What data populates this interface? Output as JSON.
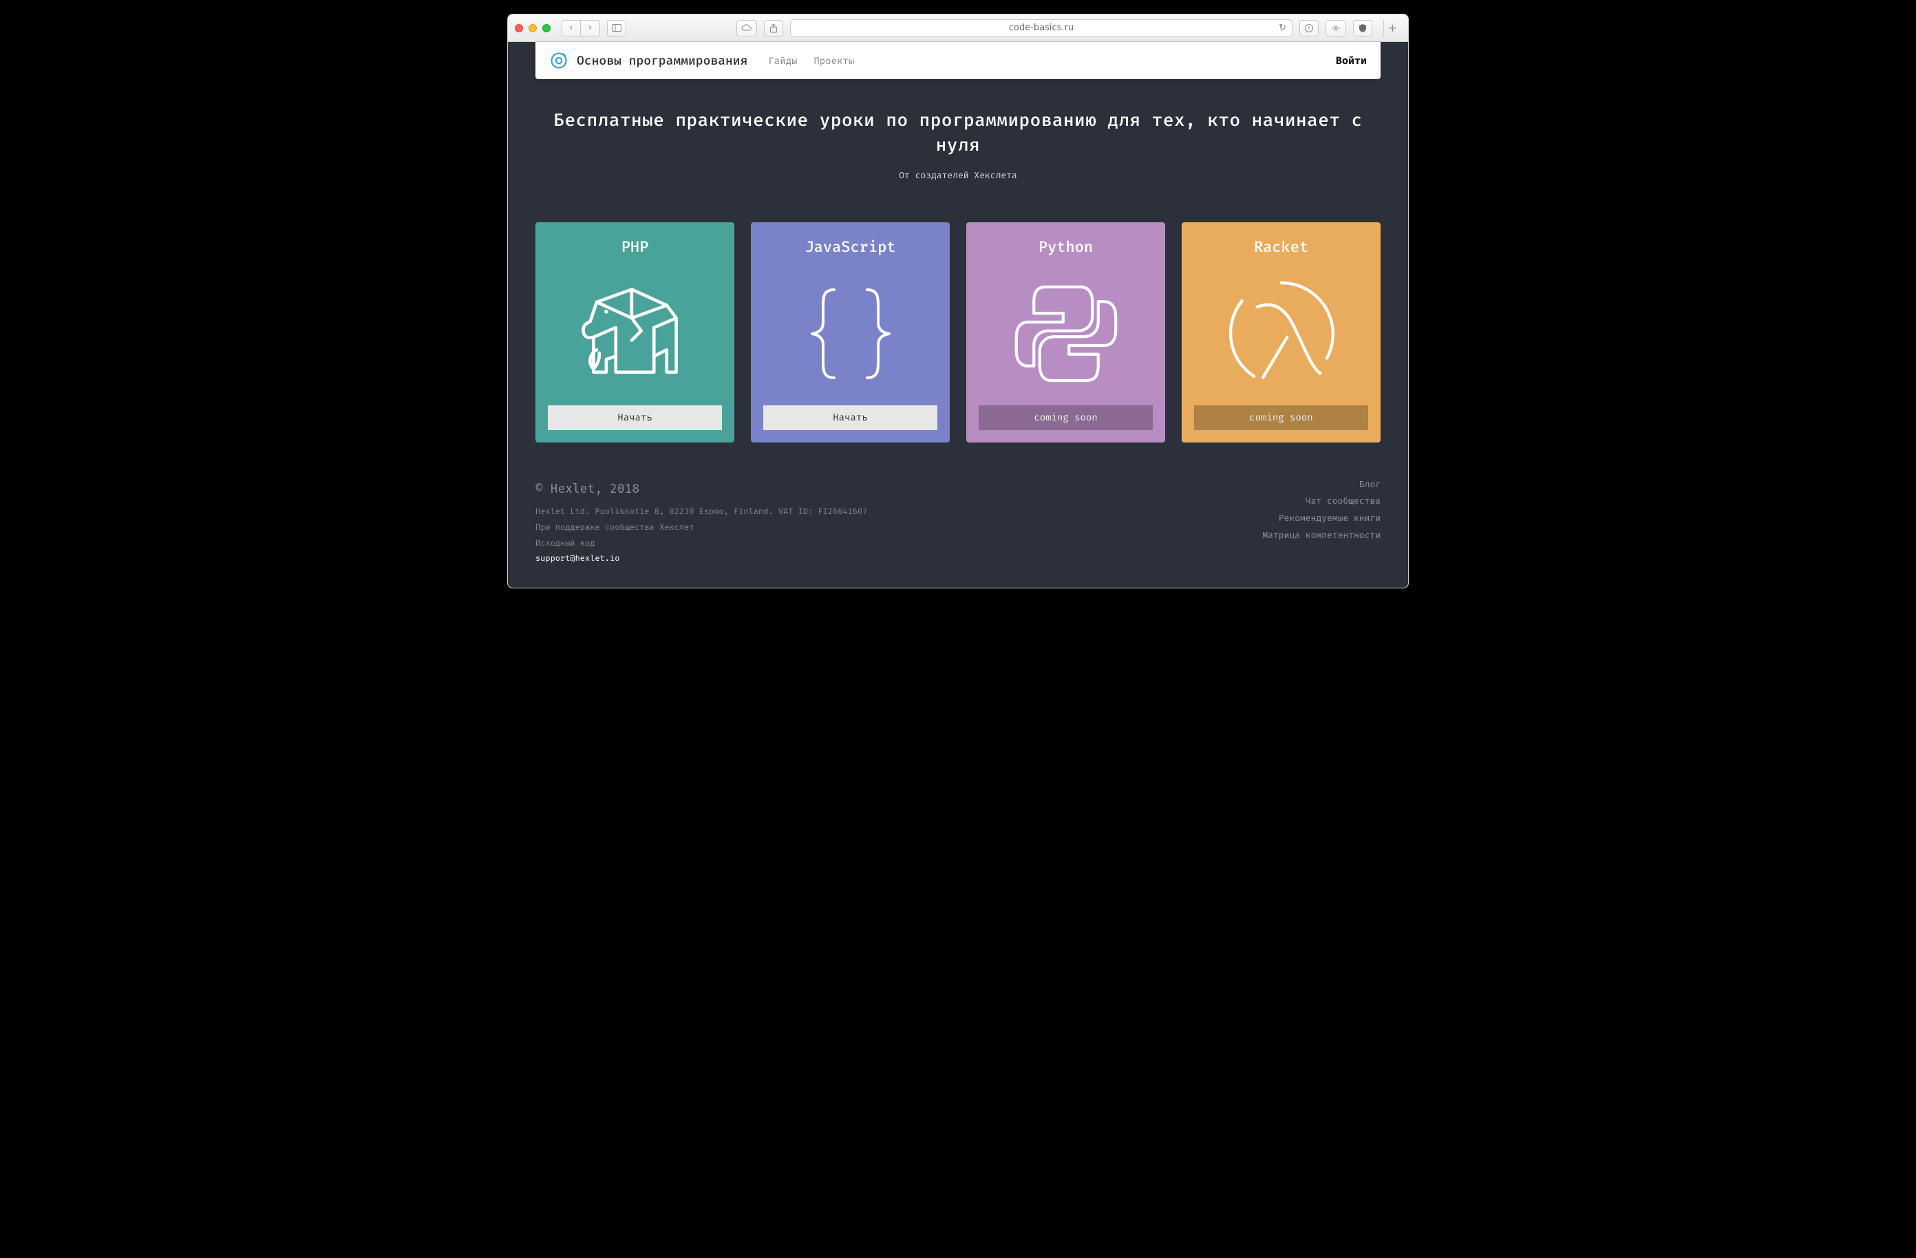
{
  "browser": {
    "url": "code-basics.ru"
  },
  "nav": {
    "brand": "Основы программирования",
    "menu": {
      "guides": "Гайды",
      "projects": "Проекты"
    },
    "login": "Войти"
  },
  "hero": {
    "title": "Бесплатные практические уроки по программированию для тех, кто начинает с нуля",
    "subtitle": "От создателей Хекслета"
  },
  "cards": {
    "php": {
      "title": "PHP",
      "cta": "Начать"
    },
    "js": {
      "title": "JavaScript",
      "cta": "Начать"
    },
    "python": {
      "title": "Python",
      "cta": "coming soon"
    },
    "racket": {
      "title": "Racket",
      "cta": "coming soon"
    }
  },
  "footer": {
    "copyright": "© Hexlet, 2018",
    "address": "Hexlet Ltd. Puolikkotie 8, 02230 Espoo, Finland. VAT ID: FI26641607",
    "support": "При поддержке сообщества Хекслет",
    "source": "Исходный код",
    "email": "support@hexlet.io",
    "links": {
      "blog": "Блог",
      "chat": "Чат сообщества",
      "books": "Рекомендуемые книги",
      "matrix": "Матрица компетентности"
    }
  }
}
